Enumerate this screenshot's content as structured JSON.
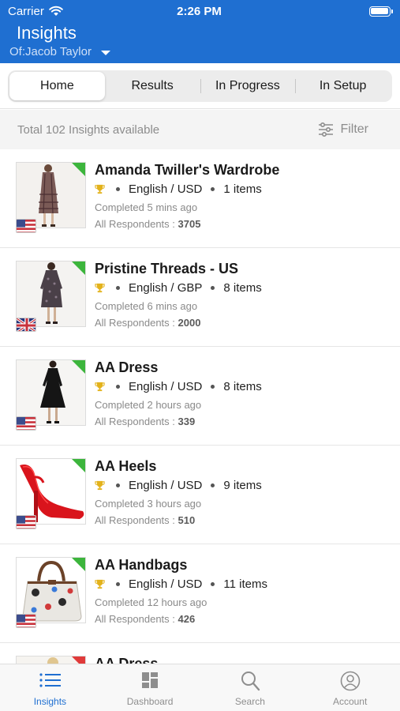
{
  "status_bar": {
    "carrier": "Carrier",
    "time": "2:26 PM"
  },
  "header": {
    "title": "Insights",
    "subtitle": "Of:Jacob Taylor"
  },
  "tabs": [
    {
      "label": "Home",
      "active": true
    },
    {
      "label": "Results",
      "active": false
    },
    {
      "label": "In Progress",
      "active": false
    },
    {
      "label": "In Setup",
      "active": false
    }
  ],
  "summary": {
    "total_text": "Total 102 Insights available",
    "filter_label": "Filter"
  },
  "insights": [
    {
      "name": "Amanda Twiller's Wardrobe",
      "language": "English / USD",
      "items": "1 items",
      "completed": "Completed 5 mins ago",
      "respondents_label": "All Respondents :",
      "respondents": "3705",
      "flag": "us-flag-icon",
      "status_color": "#3cb53c",
      "product": "dress-plaid"
    },
    {
      "name": "Pristine Threads - US",
      "language": "English / GBP",
      "items": "8 items",
      "completed": "Completed 6 mins ago",
      "respondents_label": "All Respondents :",
      "respondents": "2000",
      "flag": "uk-flag-icon",
      "status_color": "#3cb53c",
      "product": "dress-patterned"
    },
    {
      "name": "AA Dress",
      "language": "English / USD",
      "items": "8 items",
      "completed": "Completed 2 hours ago",
      "respondents_label": "All Respondents :",
      "respondents": "339",
      "flag": "us-flag-icon",
      "status_color": "#3cb53c",
      "product": "dress-black"
    },
    {
      "name": "AA Heels",
      "language": "English / USD",
      "items": "9 items",
      "completed": "Completed 3 hours ago",
      "respondents_label": "All Respondents :",
      "respondents": "510",
      "flag": "us-flag-icon",
      "status_color": "#3cb53c",
      "product": "red-heel"
    },
    {
      "name": "AA Handbags",
      "language": "English / USD",
      "items": "11 items",
      "completed": "Completed 12 hours ago",
      "respondents_label": "All Respondents :",
      "respondents": "426",
      "flag": "us-flag-icon",
      "status_color": "#3cb53c",
      "product": "handbag"
    },
    {
      "name": "AA Dress",
      "status_color": "#e03a3a",
      "product": "dress-partial"
    }
  ],
  "bottom_nav": [
    {
      "label": "Insights",
      "icon": "list-icon",
      "active": true
    },
    {
      "label": "Dashboard",
      "icon": "dashboard-icon",
      "active": false
    },
    {
      "label": "Search",
      "icon": "search-icon",
      "active": false
    },
    {
      "label": "Account",
      "icon": "account-icon",
      "active": false
    }
  ],
  "colors": {
    "brand": "#1f6fd1",
    "status_complete": "#3cb53c",
    "status_alert": "#e03a3a",
    "trophy": "#e3b21b"
  }
}
